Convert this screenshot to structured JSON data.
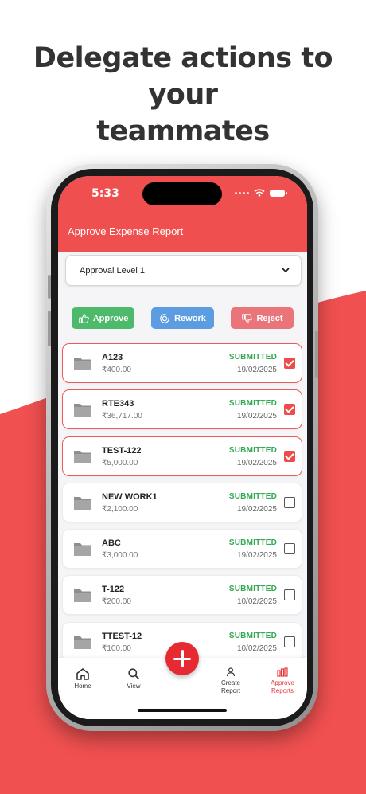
{
  "headline": {
    "line1": "Delegate actions to your",
    "line2": "teammates"
  },
  "colors": {
    "accent": "#f04f4f",
    "approve": "#4cba6a",
    "rework": "#5b9de0",
    "reject": "#e97479",
    "status_green": "#34a853"
  },
  "status_bar": {
    "time": "5:33"
  },
  "header": {
    "title": "Approve Expense Report"
  },
  "approval_select": {
    "value": "Approval Level 1"
  },
  "actions": {
    "approve": "Approve",
    "rework": "Rework",
    "reject": "Reject"
  },
  "reports": [
    {
      "name": "A123",
      "amount": "₹400.00",
      "status": "SUBMITTED",
      "date": "19/02/2025",
      "checked": true
    },
    {
      "name": "RTE343",
      "amount": "₹36,717.00",
      "status": "SUBMITTED",
      "date": "19/02/2025",
      "checked": true
    },
    {
      "name": "TEST-122",
      "amount": "₹5,000.00",
      "status": "SUBMITTED",
      "date": "19/02/2025",
      "checked": true
    },
    {
      "name": "NEW WORK1",
      "amount": "₹2,100.00",
      "status": "SUBMITTED",
      "date": "19/02/2025",
      "checked": false
    },
    {
      "name": "ABC",
      "amount": "₹3,000.00",
      "status": "SUBMITTED",
      "date": "19/02/2025",
      "checked": false
    },
    {
      "name": "T-122",
      "amount": "₹200.00",
      "status": "SUBMITTED",
      "date": "10/02/2025",
      "checked": false
    },
    {
      "name": "TTEST-12",
      "amount": "₹100.00",
      "status": "SUBMITTED",
      "date": "10/02/2025",
      "checked": false
    }
  ],
  "nav": {
    "home": "Home",
    "view": "View",
    "create_line1": "Create",
    "create_line2": "Report",
    "approve_line1": "Approve",
    "approve_line2": "Reports"
  }
}
